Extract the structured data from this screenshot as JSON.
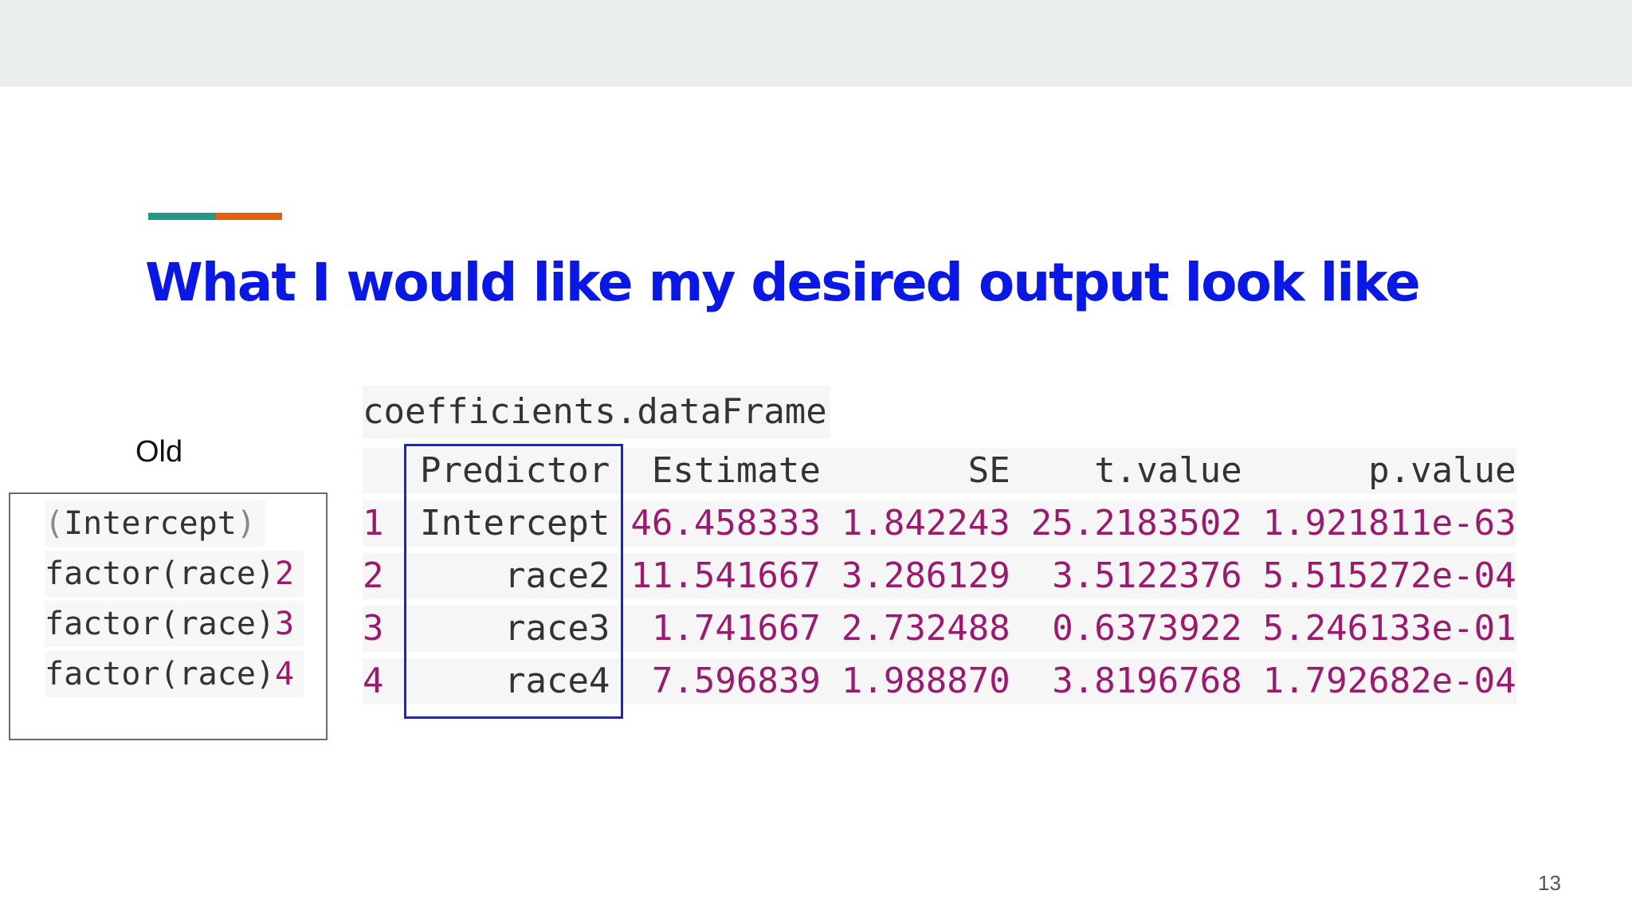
{
  "slide": {
    "title": "What I would like my desired output look like",
    "page_number": "13",
    "colors": {
      "title": "#0a18e6",
      "accent_teal": "#21998a",
      "accent_orange": "#e0620f",
      "value_color": "#9a1a6f"
    }
  },
  "old": {
    "label": "Old",
    "lines": [
      {
        "open": "(",
        "text": "Intercept",
        "close": ")",
        "suffix": ""
      },
      {
        "open": "factor(",
        "text": "race",
        "close": ")",
        "suffix": "2"
      },
      {
        "open": "factor(",
        "text": "race",
        "close": ")",
        "suffix": "3"
      },
      {
        "open": "factor(",
        "text": "race",
        "close": ")",
        "suffix": "4"
      }
    ]
  },
  "dataframe": {
    "name": "coefficients.dataFrame",
    "columns": [
      "Predictor",
      "Estimate",
      "SE",
      "t.value",
      "p.value"
    ],
    "rows": [
      {
        "index": "1",
        "predictor": "Intercept",
        "estimate": "46.458333",
        "se": "1.842243",
        "t_value": "25.2183502",
        "p_value": "1.921811e-63"
      },
      {
        "index": "2",
        "predictor": "race2",
        "estimate": "11.541667",
        "se": "3.286129",
        "t_value": "3.5122376",
        "p_value": "5.515272e-04"
      },
      {
        "index": "3",
        "predictor": "race3",
        "estimate": "1.741667",
        "se": "2.732488",
        "t_value": "0.6373922",
        "p_value": "5.246133e-01"
      },
      {
        "index": "4",
        "predictor": "race4",
        "estimate": "7.596839",
        "se": "1.988870",
        "t_value": "3.8196768",
        "p_value": "1.792682e-04"
      }
    ]
  }
}
